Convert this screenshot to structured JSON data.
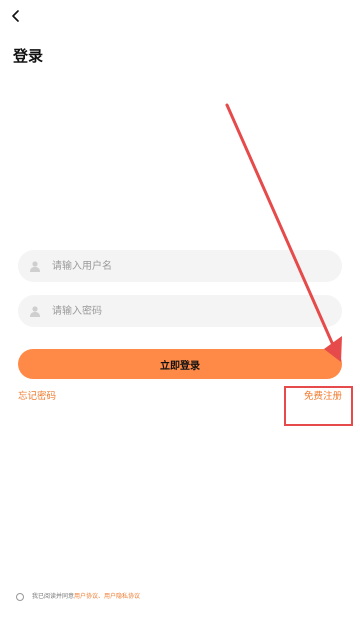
{
  "header": {
    "back_icon": "chevron-left-icon",
    "title": "登录"
  },
  "form": {
    "username": {
      "placeholder": "请输入用户名",
      "value": "",
      "icon": "user-icon"
    },
    "password": {
      "placeholder": "请输入密码",
      "value": "",
      "icon": "user-icon"
    },
    "login_label": "立即登录",
    "forgot_label": "忘记密码",
    "register_label": "免费注册"
  },
  "agreement": {
    "prefix": "我已阅读并同意",
    "user_agreement": "用户协议",
    "separator": "、",
    "privacy_agreement": "用户隐私协议"
  },
  "colors": {
    "accent": "#ff8a48",
    "link": "#f07a2e",
    "annotation": "#e64a4a",
    "field_bg": "#f4f4f4"
  }
}
